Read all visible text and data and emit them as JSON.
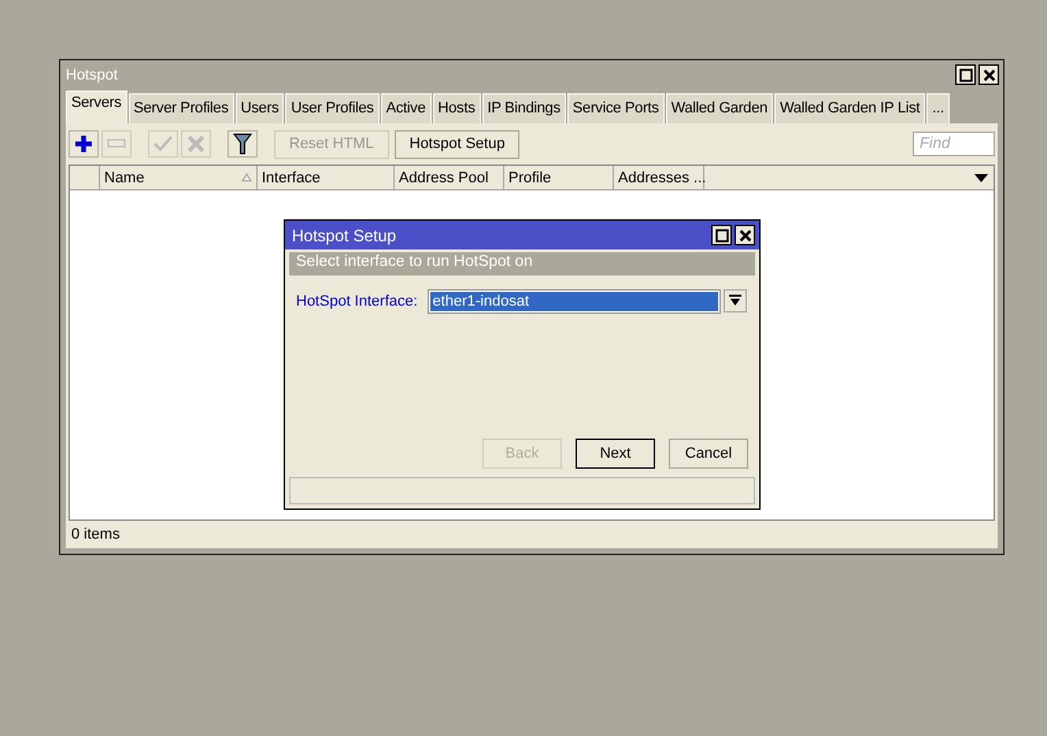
{
  "window": {
    "title": "Hotspot"
  },
  "tabs": [
    {
      "label": "Servers",
      "selected": true
    },
    {
      "label": "Server Profiles",
      "selected": false
    },
    {
      "label": "Users",
      "selected": false
    },
    {
      "label": "User Profiles",
      "selected": false
    },
    {
      "label": "Active",
      "selected": false
    },
    {
      "label": "Hosts",
      "selected": false
    },
    {
      "label": "IP Bindings",
      "selected": false
    },
    {
      "label": "Service Ports",
      "selected": false
    },
    {
      "label": "Walled Garden",
      "selected": false
    },
    {
      "label": "Walled Garden IP List",
      "selected": false
    },
    {
      "label": "...",
      "selected": false
    }
  ],
  "toolbar": {
    "icon_buttons": [
      {
        "kind": "add",
        "disabled": false
      },
      {
        "kind": "remove",
        "disabled": true
      },
      {
        "kind": "enable",
        "disabled": true
      },
      {
        "kind": "disable",
        "disabled": true
      },
      {
        "kind": "filter",
        "disabled": false
      }
    ],
    "text_buttons": [
      {
        "label": "Reset HTML",
        "disabled": true
      },
      {
        "label": "Hotspot Setup",
        "disabled": false
      }
    ],
    "search": {
      "placeholder": "Find"
    }
  },
  "table": {
    "columns": [
      {
        "label": "Name",
        "sorted": true
      },
      {
        "label": "Interface",
        "sorted": false
      },
      {
        "label": "Address Pool",
        "sorted": false
      },
      {
        "label": "Profile",
        "sorted": false
      },
      {
        "label": "Addresses ...",
        "sorted": false
      }
    ]
  },
  "status_bar": "0 items",
  "dialog": {
    "title": "Hotspot Setup",
    "banner": "Select interface to run HotSpot on",
    "field": {
      "label": "HotSpot Interface:",
      "value": "ether1-indosat"
    },
    "buttons": [
      {
        "label": "Back",
        "disabled": true,
        "default": false
      },
      {
        "label": "Next",
        "disabled": false,
        "default": true
      },
      {
        "label": "Cancel",
        "disabled": false,
        "default": false
      }
    ]
  }
}
